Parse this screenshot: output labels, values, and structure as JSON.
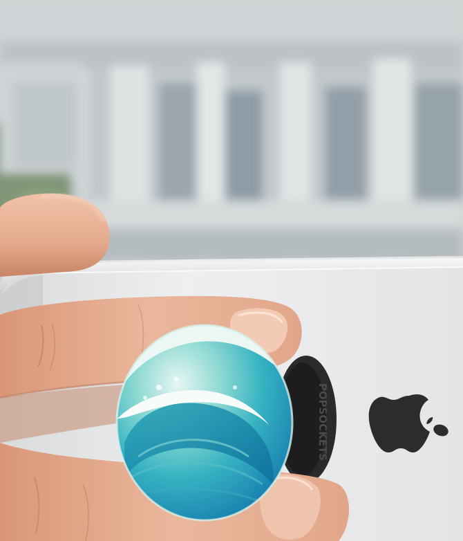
{
  "photo": {
    "grip_text": "POPSOCKETS",
    "colors": {
      "sky": "#dfe3e4",
      "building": "#c9ced1",
      "column": "#e2e5e6",
      "window": "#9ea9b0",
      "foliage": "#7f9577",
      "phone_body": "#e7e8ea",
      "skin": "#e9b59a",
      "skin_shadow": "#c98466",
      "grip_base": "#2a2a2c",
      "wave_light": "#d9f1ee",
      "wave_mid": "#4cc3c6",
      "wave_deep": "#1a86b4",
      "apple_logo": "#2c2c2e"
    }
  }
}
